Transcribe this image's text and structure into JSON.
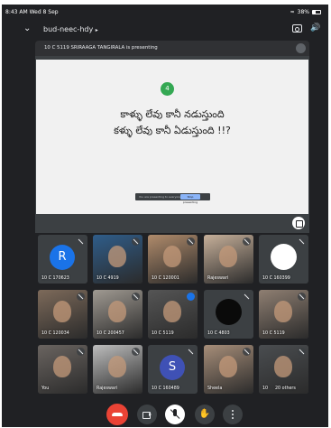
{
  "status_bar": {
    "time_date": "8:43 AM  Wed 8 Sep",
    "battery_percent": "38%"
  },
  "top_bar": {
    "meeting_code": "bud-neec-hdy",
    "chevron": "chevron-right-icon"
  },
  "presentation": {
    "presenter_label": "10 C 5119 SRIRAAGA TANGIRALA is presenting",
    "slide_badge": "4",
    "slide_line_1": "కాళ్ళు లేవు కానీ నడుస్తుంది",
    "slide_line_2": "కళ్ళు లేవు కానీ ఏడుస్తుంది !!?",
    "share_bar_text": "You are presenting to everyone",
    "share_bar_button": "Stop presenting"
  },
  "participants": [
    {
      "name": "10 C 170623",
      "kind": "initial",
      "initial": "R",
      "color": "#1a73e8"
    },
    {
      "name": "10 C 4919",
      "kind": "photo",
      "color": "#2f5d8a"
    },
    {
      "name": "10 C 120001",
      "kind": "photo",
      "color": "#b08b6b"
    },
    {
      "name": "Rajeswari",
      "kind": "photo",
      "color": "#c7b09a"
    },
    {
      "name": "10 C 160399",
      "kind": "blank",
      "color": "#ffffff"
    },
    {
      "name": "10 C 120034",
      "kind": "photo",
      "color": "#7d6a5a"
    },
    {
      "name": "10 C 200457",
      "kind": "photo",
      "color": "#a09a92"
    },
    {
      "name": "10 C 5119",
      "kind": "photo",
      "color": "#555555",
      "speaking": true
    },
    {
      "name": "10 C 4803",
      "kind": "blank",
      "color": "#0a0a0a"
    },
    {
      "name": "10 C 5119",
      "kind": "photo",
      "color": "#8f7f72"
    },
    {
      "name": "You",
      "kind": "photo",
      "color": "#6a6460"
    },
    {
      "name": "Rajeswari",
      "kind": "photo",
      "color": "#bdbdbd"
    },
    {
      "name": "10 C 160489",
      "kind": "initial",
      "initial": "S",
      "color": "#3f51b5"
    },
    {
      "name": "Sheela",
      "kind": "photo",
      "color": "#a78e79"
    },
    {
      "name": "10",
      "kind": "others",
      "others_label": "20 others",
      "color": "#4a4d50"
    }
  ],
  "controls": {
    "end_call": "end-call-icon",
    "camera": "camera-icon",
    "microphone": "mic-off-icon",
    "raise_hand": "hand-icon",
    "more": "more-vert-icon"
  },
  "colors": {
    "background": "#202124",
    "end_call": "#ea4335",
    "accent": "#8ab4f8"
  }
}
